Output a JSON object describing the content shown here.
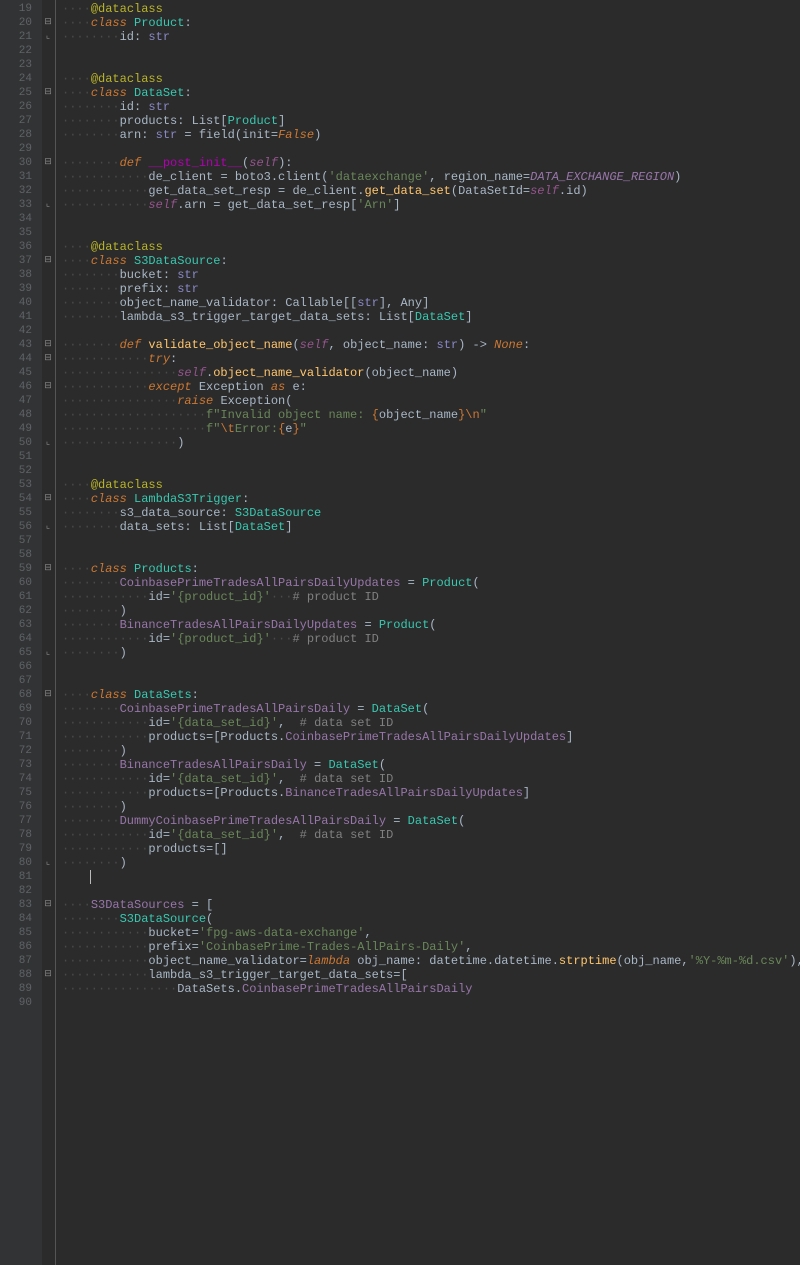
{
  "gutter": {
    "start": 19,
    "end": 90
  },
  "caret": {
    "line": 81,
    "col": 0
  },
  "tokens": [
    [
      [
        "ws",
        "····"
      ],
      [
        "deco",
        "@dataclass"
      ]
    ],
    [
      [
        "ws",
        "····"
      ],
      [
        "kw",
        "class "
      ],
      [
        "cls",
        "Product"
      ],
      [
        "op",
        ":"
      ]
    ],
    [
      [
        "ws",
        "········"
      ],
      [
        "py",
        "id"
      ],
      [
        "op",
        ": "
      ],
      [
        "builtin",
        "str"
      ]
    ],
    [],
    [],
    [
      [
        "ws",
        "····"
      ],
      [
        "deco",
        "@dataclass"
      ]
    ],
    [
      [
        "ws",
        "····"
      ],
      [
        "kw",
        "class "
      ],
      [
        "cls",
        "DataSet"
      ],
      [
        "op",
        ":"
      ]
    ],
    [
      [
        "ws",
        "········"
      ],
      [
        "py",
        "id"
      ],
      [
        "op",
        ": "
      ],
      [
        "builtin",
        "str"
      ]
    ],
    [
      [
        "ws",
        "········"
      ],
      [
        "py",
        "products"
      ],
      [
        "op",
        ": "
      ],
      [
        "py",
        "List["
      ],
      [
        "cls",
        "Product"
      ],
      [
        "py",
        "]"
      ]
    ],
    [
      [
        "ws",
        "········"
      ],
      [
        "py",
        "arn"
      ],
      [
        "op",
        ": "
      ],
      [
        "builtin",
        "str"
      ],
      [
        "op",
        " = "
      ],
      [
        "py",
        "field("
      ],
      [
        "param",
        "init"
      ],
      [
        "op",
        "="
      ],
      [
        "kw",
        "False"
      ],
      [
        "py",
        ")"
      ]
    ],
    [],
    [
      [
        "ws",
        "········"
      ],
      [
        "kw",
        "def "
      ],
      [
        "dunder",
        "__post_init__"
      ],
      [
        "py",
        "("
      ],
      [
        "self",
        "self"
      ],
      [
        "py",
        ")"
      ],
      [
        "op",
        ":"
      ]
    ],
    [
      [
        "ws",
        "············"
      ],
      [
        "py",
        "de_client "
      ],
      [
        "op",
        "="
      ],
      [
        "py",
        " boto3.client("
      ],
      [
        "str",
        "'dataexchange'"
      ],
      [
        "op",
        ", "
      ],
      [
        "param",
        "region_name"
      ],
      [
        "op",
        "="
      ],
      [
        "const",
        "DATA_EXCHANGE_REGION"
      ],
      [
        "py",
        ")"
      ]
    ],
    [
      [
        "ws",
        "············"
      ],
      [
        "py",
        "get_data_set_resp "
      ],
      [
        "op",
        "="
      ],
      [
        "py",
        " de_client."
      ],
      [
        "fn",
        "get_data_set"
      ],
      [
        "py",
        "("
      ],
      [
        "param",
        "DataSetId"
      ],
      [
        "op",
        "="
      ],
      [
        "self",
        "self"
      ],
      [
        "py",
        ".id)"
      ]
    ],
    [
      [
        "ws",
        "············"
      ],
      [
        "self",
        "self"
      ],
      [
        "py",
        ".arn "
      ],
      [
        "op",
        "="
      ],
      [
        "py",
        " get_data_set_resp["
      ],
      [
        "str",
        "'Arn'"
      ],
      [
        "py",
        "]"
      ]
    ],
    [],
    [],
    [
      [
        "ws",
        "····"
      ],
      [
        "deco",
        "@dataclass"
      ]
    ],
    [
      [
        "ws",
        "····"
      ],
      [
        "kw",
        "class "
      ],
      [
        "cls",
        "S3DataSource"
      ],
      [
        "op",
        ":"
      ]
    ],
    [
      [
        "ws",
        "········"
      ],
      [
        "py",
        "bucket"
      ],
      [
        "op",
        ": "
      ],
      [
        "builtin",
        "str"
      ]
    ],
    [
      [
        "ws",
        "········"
      ],
      [
        "py",
        "prefix"
      ],
      [
        "op",
        ": "
      ],
      [
        "builtin",
        "str"
      ]
    ],
    [
      [
        "ws",
        "········"
      ],
      [
        "py",
        "object_name_validator"
      ],
      [
        "op",
        ": "
      ],
      [
        "py",
        "Callable[["
      ],
      [
        "builtin",
        "str"
      ],
      [
        "py",
        "], Any]"
      ]
    ],
    [
      [
        "ws",
        "········"
      ],
      [
        "py",
        "lambda_s3_trigger_target_data_sets"
      ],
      [
        "op",
        ": "
      ],
      [
        "py",
        "List["
      ],
      [
        "cls",
        "DataSet"
      ],
      [
        "py",
        "]"
      ]
    ],
    [],
    [
      [
        "ws",
        "········"
      ],
      [
        "kw",
        "def "
      ],
      [
        "fn",
        "validate_object_name"
      ],
      [
        "py",
        "("
      ],
      [
        "self",
        "self"
      ],
      [
        "op",
        ", "
      ],
      [
        "py",
        "object_name"
      ],
      [
        "op",
        ": "
      ],
      [
        "builtin",
        "str"
      ],
      [
        "py",
        ") -> "
      ],
      [
        "kw",
        "None"
      ],
      [
        "op",
        ":"
      ]
    ],
    [
      [
        "ws",
        "············"
      ],
      [
        "kw",
        "try"
      ],
      [
        "op",
        ":"
      ]
    ],
    [
      [
        "ws",
        "················"
      ],
      [
        "self",
        "self"
      ],
      [
        "py",
        "."
      ],
      [
        "fn",
        "object_name_validator"
      ],
      [
        "py",
        "(object_name)"
      ]
    ],
    [
      [
        "ws",
        "············"
      ],
      [
        "kw",
        "except "
      ],
      [
        "py",
        "Exception "
      ],
      [
        "kw",
        "as "
      ],
      [
        "py",
        "e"
      ],
      [
        "op",
        ":"
      ]
    ],
    [
      [
        "ws",
        "················"
      ],
      [
        "kw",
        "raise "
      ],
      [
        "py",
        "Exception("
      ]
    ],
    [
      [
        "ws",
        "····················"
      ],
      [
        "str",
        "f\"Invalid object name: "
      ],
      [
        "strf",
        "{"
      ],
      [
        "py",
        "object_name"
      ],
      [
        "strf",
        "}"
      ],
      [
        "kw2",
        "\\n"
      ],
      [
        "str",
        "\""
      ]
    ],
    [
      [
        "ws",
        "····················"
      ],
      [
        "str",
        "f\""
      ],
      [
        "kw2",
        "\\t"
      ],
      [
        "str",
        "Error:"
      ],
      [
        "strf",
        "{"
      ],
      [
        "py",
        "e"
      ],
      [
        "strf",
        "}"
      ],
      [
        "str",
        "\""
      ]
    ],
    [
      [
        "ws",
        "················"
      ],
      [
        "py",
        ")"
      ]
    ],
    [],
    [],
    [
      [
        "ws",
        "····"
      ],
      [
        "deco",
        "@dataclass"
      ]
    ],
    [
      [
        "ws",
        "····"
      ],
      [
        "kw",
        "class "
      ],
      [
        "cls",
        "LambdaS3Trigger"
      ],
      [
        "op",
        ":"
      ]
    ],
    [
      [
        "ws",
        "········"
      ],
      [
        "py",
        "s3_data_source"
      ],
      [
        "op",
        ": "
      ],
      [
        "cls",
        "S3DataSource"
      ]
    ],
    [
      [
        "ws",
        "········"
      ],
      [
        "py",
        "data_sets"
      ],
      [
        "op",
        ": "
      ],
      [
        "py",
        "List["
      ],
      [
        "cls",
        "DataSet"
      ],
      [
        "py",
        "]"
      ]
    ],
    [],
    [],
    [
      [
        "ws",
        "····"
      ],
      [
        "kw",
        "class "
      ],
      [
        "cls",
        "Products"
      ],
      [
        "op",
        ":"
      ]
    ],
    [
      [
        "ws",
        "········"
      ],
      [
        "field",
        "CoinbasePrimeTradesAllPairsDailyUpdates"
      ],
      [
        "op",
        " = "
      ],
      [
        "cls",
        "Product"
      ],
      [
        "py",
        "("
      ]
    ],
    [
      [
        "ws",
        "············"
      ],
      [
        "param",
        "id"
      ],
      [
        "op",
        "="
      ],
      [
        "str",
        "'{product_id}'"
      ],
      [
        "ws",
        "···"
      ],
      [
        "cmt",
        "# product ID"
      ]
    ],
    [
      [
        "ws",
        "········"
      ],
      [
        "py",
        ")"
      ]
    ],
    [
      [
        "ws",
        "········"
      ],
      [
        "field",
        "BinanceTradesAllPairsDailyUpdates"
      ],
      [
        "op",
        " = "
      ],
      [
        "cls",
        "Product"
      ],
      [
        "py",
        "("
      ]
    ],
    [
      [
        "ws",
        "············"
      ],
      [
        "param",
        "id"
      ],
      [
        "op",
        "="
      ],
      [
        "str",
        "'{product_id}'"
      ],
      [
        "ws",
        "···"
      ],
      [
        "cmt",
        "# product ID"
      ]
    ],
    [
      [
        "ws",
        "········"
      ],
      [
        "py",
        ")"
      ]
    ],
    [],
    [],
    [
      [
        "ws",
        "····"
      ],
      [
        "kw",
        "class "
      ],
      [
        "cls",
        "DataSets"
      ],
      [
        "op",
        ":"
      ]
    ],
    [
      [
        "ws",
        "········"
      ],
      [
        "field",
        "CoinbasePrimeTradesAllPairsDaily"
      ],
      [
        "op",
        " = "
      ],
      [
        "cls",
        "DataSet"
      ],
      [
        "py",
        "("
      ]
    ],
    [
      [
        "ws",
        "············"
      ],
      [
        "param",
        "id"
      ],
      [
        "op",
        "="
      ],
      [
        "str",
        "'{data_set_id}'"
      ],
      [
        "op",
        ",  "
      ],
      [
        "cmt",
        "# data set ID"
      ]
    ],
    [
      [
        "ws",
        "············"
      ],
      [
        "param",
        "products"
      ],
      [
        "op",
        "="
      ],
      [
        "py",
        "[Products."
      ],
      [
        "field",
        "CoinbasePrimeTradesAllPairsDailyUpdates"
      ],
      [
        "py",
        "]"
      ]
    ],
    [
      [
        "ws",
        "········"
      ],
      [
        "py",
        ")"
      ]
    ],
    [
      [
        "ws",
        "········"
      ],
      [
        "field",
        "BinanceTradesAllPairsDaily"
      ],
      [
        "op",
        " = "
      ],
      [
        "cls",
        "DataSet"
      ],
      [
        "py",
        "("
      ]
    ],
    [
      [
        "ws",
        "············"
      ],
      [
        "param",
        "id"
      ],
      [
        "op",
        "="
      ],
      [
        "str",
        "'{data_set_id}'"
      ],
      [
        "op",
        ",  "
      ],
      [
        "cmt",
        "# data set ID"
      ]
    ],
    [
      [
        "ws",
        "············"
      ],
      [
        "param",
        "products"
      ],
      [
        "op",
        "="
      ],
      [
        "py",
        "[Products."
      ],
      [
        "field",
        "BinanceTradesAllPairsDailyUpdates"
      ],
      [
        "py",
        "]"
      ]
    ],
    [
      [
        "ws",
        "········"
      ],
      [
        "py",
        ")"
      ]
    ],
    [
      [
        "ws",
        "········"
      ],
      [
        "field",
        "DummyCoinbasePrimeTradesAllPairsDaily"
      ],
      [
        "op",
        " = "
      ],
      [
        "cls",
        "DataSet"
      ],
      [
        "py",
        "("
      ]
    ],
    [
      [
        "ws",
        "············"
      ],
      [
        "param",
        "id"
      ],
      [
        "op",
        "="
      ],
      [
        "str",
        "'{data_set_id}'"
      ],
      [
        "op",
        ",  "
      ],
      [
        "cmt",
        "# data set ID"
      ]
    ],
    [
      [
        "ws",
        "············"
      ],
      [
        "param",
        "products"
      ],
      [
        "op",
        "="
      ],
      [
        "py",
        "[]"
      ]
    ],
    [
      [
        "ws",
        "········"
      ],
      [
        "py",
        ")"
      ]
    ],
    [],
    [],
    [
      [
        "ws",
        "····"
      ],
      [
        "field",
        "S3DataSources"
      ],
      [
        "op",
        " = "
      ],
      [
        "py",
        "["
      ]
    ],
    [
      [
        "ws",
        "········"
      ],
      [
        "cls",
        "S3DataSource"
      ],
      [
        "py",
        "("
      ]
    ],
    [
      [
        "ws",
        "············"
      ],
      [
        "param",
        "bucket"
      ],
      [
        "op",
        "="
      ],
      [
        "str",
        "'fpg-aws-data-exchange'"
      ],
      [
        "op",
        ","
      ]
    ],
    [
      [
        "ws",
        "············"
      ],
      [
        "param",
        "prefix"
      ],
      [
        "op",
        "="
      ],
      [
        "str",
        "'CoinbasePrime-Trades-AllPairs-Daily'"
      ],
      [
        "op",
        ","
      ]
    ],
    [
      [
        "ws",
        "············"
      ],
      [
        "param",
        "object_name_validator"
      ],
      [
        "op",
        "="
      ],
      [
        "kw",
        "lambda "
      ],
      [
        "py",
        "obj_name"
      ],
      [
        "op",
        ": "
      ],
      [
        "py",
        "datetime.datetime."
      ],
      [
        "fn",
        "strptime"
      ],
      [
        "py",
        "(obj_name"
      ],
      [
        "op",
        ","
      ],
      [
        "str",
        "'%Y-%m-%d.csv'"
      ],
      [
        "py",
        "),"
      ]
    ],
    [
      [
        "ws",
        "············"
      ],
      [
        "param",
        "lambda_s3_trigger_target_data_sets"
      ],
      [
        "op",
        "="
      ],
      [
        "py",
        "["
      ]
    ],
    [
      [
        "ws",
        "················"
      ],
      [
        "py",
        "DataSets."
      ],
      [
        "field",
        "CoinbasePrimeTradesAllPairsDaily"
      ]
    ],
    []
  ],
  "folds": [
    {
      "line": 20,
      "type": "open"
    },
    {
      "line": 21,
      "type": "close"
    },
    {
      "line": 25,
      "type": "open"
    },
    {
      "line": 30,
      "type": "open"
    },
    {
      "line": 33,
      "type": "close"
    },
    {
      "line": 37,
      "type": "open"
    },
    {
      "line": 43,
      "type": "open"
    },
    {
      "line": 44,
      "type": "open"
    },
    {
      "line": 46,
      "type": "open"
    },
    {
      "line": 50,
      "type": "close"
    },
    {
      "line": 54,
      "type": "open"
    },
    {
      "line": 56,
      "type": "close"
    },
    {
      "line": 59,
      "type": "open"
    },
    {
      "line": 65,
      "type": "close"
    },
    {
      "line": 68,
      "type": "open"
    },
    {
      "line": 80,
      "type": "close"
    },
    {
      "line": 83,
      "type": "open"
    },
    {
      "line": 88,
      "type": "open"
    }
  ]
}
